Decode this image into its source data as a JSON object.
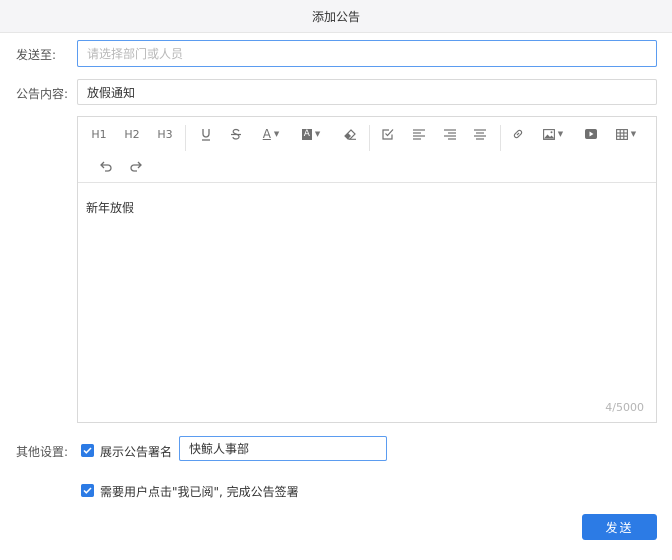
{
  "dialog": {
    "title": "添加公告"
  },
  "form": {
    "send_to_label": "发送至:",
    "send_to_placeholder": "请选择部门或人员",
    "content_label": "公告内容:",
    "title_value": "放假通知",
    "other_label": "其他设置:",
    "show_signature_label": "展示公告署名",
    "signature_value": "快鲸人事部",
    "require_confirm_label": "需要用户点击\"我已阅\", 完成公告签署",
    "show_signature_checked": true,
    "require_confirm_checked": true
  },
  "editor": {
    "toolbar": {
      "h1": "H1",
      "h2": "H2",
      "h3": "H3",
      "text_color_letter": "A",
      "bg_color_letter": "A"
    },
    "body_text": "新年放假",
    "counter": "4/5000"
  },
  "actions": {
    "send_label": "发送"
  }
}
